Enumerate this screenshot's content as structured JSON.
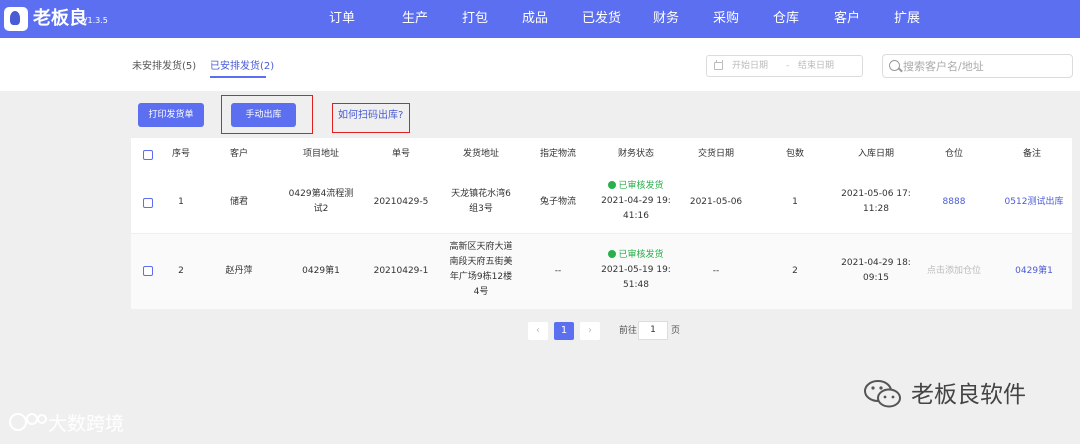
{
  "app": {
    "brand": "老板良",
    "version": "V1.3.5"
  },
  "nav": [
    "订单",
    "生产",
    "打包",
    "成品",
    "已发货",
    "财务",
    "采购",
    "仓库",
    "客户",
    "扩展"
  ],
  "tabs": {
    "unscheduled": "未安排发货(5)",
    "scheduled": "已安排发货(2)"
  },
  "filters": {
    "start_date": "开始日期",
    "separator": "-",
    "end_date": "结束日期",
    "search_placeholder": "搜索客户名/地址"
  },
  "actions": {
    "print": "打印发货单",
    "manual_out": "手动出库",
    "help": "如何扫码出库?"
  },
  "table": {
    "headers": [
      "序号",
      "客户",
      "项目地址",
      "单号",
      "发货地址",
      "指定物流",
      "财务状态",
      "交货日期",
      "包数",
      "入库日期",
      "仓位",
      "备注"
    ],
    "rows": [
      {
        "index": "1",
        "customer": "储君",
        "project_address": [
          "0429第4流程测",
          "试2"
        ],
        "order_no": "20210429-5",
        "ship_address": [
          "天龙镇花水湾6",
          "组3号"
        ],
        "logistics": "兔子物流",
        "finance_status": "已审核发货",
        "finance_time": [
          "2021-04-29 19:",
          "41:16"
        ],
        "delivery_date": "2021-05-06",
        "packages": "1",
        "in_date": [
          "2021-05-06 17:",
          "11:28"
        ],
        "location": "8888",
        "remark": "0512测试出库"
      },
      {
        "index": "2",
        "customer": "赵丹萍",
        "project_address": [
          "0429第1"
        ],
        "order_no": "20210429-1",
        "ship_address": [
          "高新区天府大道",
          "南段天府五街美",
          "年广场9栋12楼",
          "4号"
        ],
        "logistics": "--",
        "finance_status": "已审核发货",
        "finance_time": [
          "2021-05-19 19:",
          "51:48"
        ],
        "delivery_date": "--",
        "packages": "2",
        "in_date": [
          "2021-04-29 18:",
          "09:15"
        ],
        "location": "点击添加仓位",
        "remark": "0429第1"
      }
    ]
  },
  "pagination": {
    "prev": "‹",
    "current": "1",
    "next": "›",
    "goto_prefix": "前往",
    "goto_value": "1",
    "goto_suffix": "页"
  },
  "watermarks": {
    "left": "大数跨境",
    "right": "老板良软件"
  },
  "colors": {
    "primary": "#5b6ff0",
    "success": "#27b04b",
    "highlight_box": "#e02020"
  }
}
